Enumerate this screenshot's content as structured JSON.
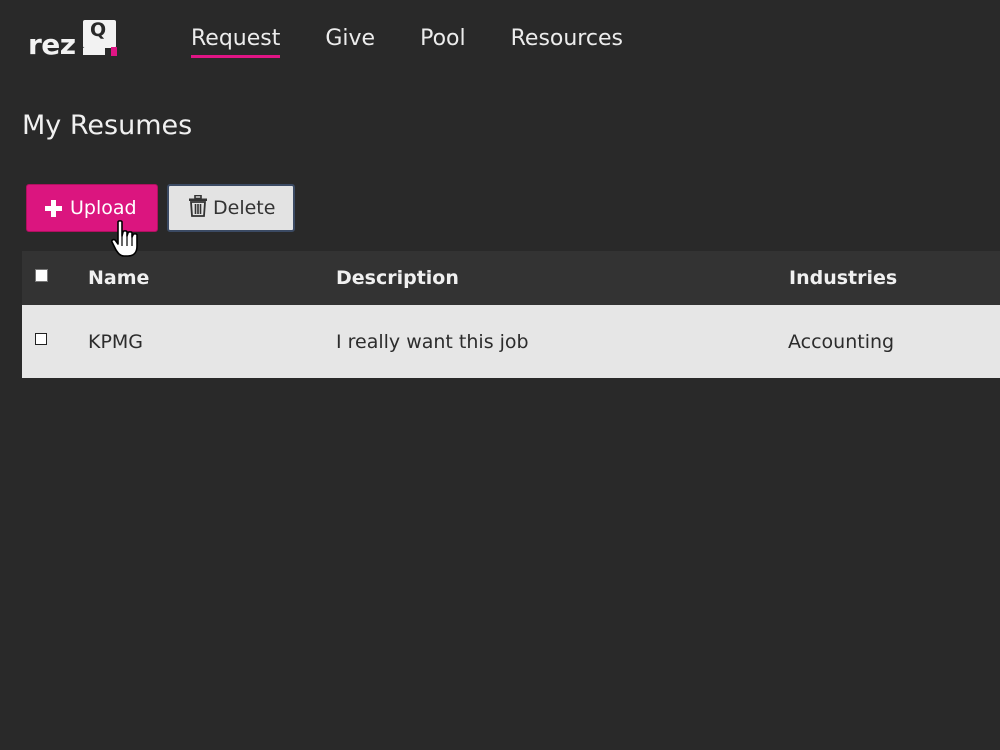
{
  "logo": {
    "text": "rez",
    "mark": "Q"
  },
  "nav": {
    "items": [
      {
        "label": "Request",
        "active": true
      },
      {
        "label": "Give",
        "active": false
      },
      {
        "label": "Pool",
        "active": false
      },
      {
        "label": "Resources",
        "active": false
      }
    ]
  },
  "page": {
    "title": "My Resumes"
  },
  "toolbar": {
    "upload_label": "Upload",
    "upload_icon": "plus-icon",
    "delete_label": "Delete",
    "delete_icon": "trash-icon"
  },
  "table": {
    "columns": [
      "Name",
      "Description",
      "Industries"
    ],
    "rows": [
      {
        "name": "KPMG",
        "description": "I really want this job",
        "industries": "Accounting",
        "checked": false
      }
    ]
  },
  "colors": {
    "accent": "#e01585",
    "background": "#292929",
    "header_row": "#333333",
    "data_row": "#e6e6e6"
  }
}
